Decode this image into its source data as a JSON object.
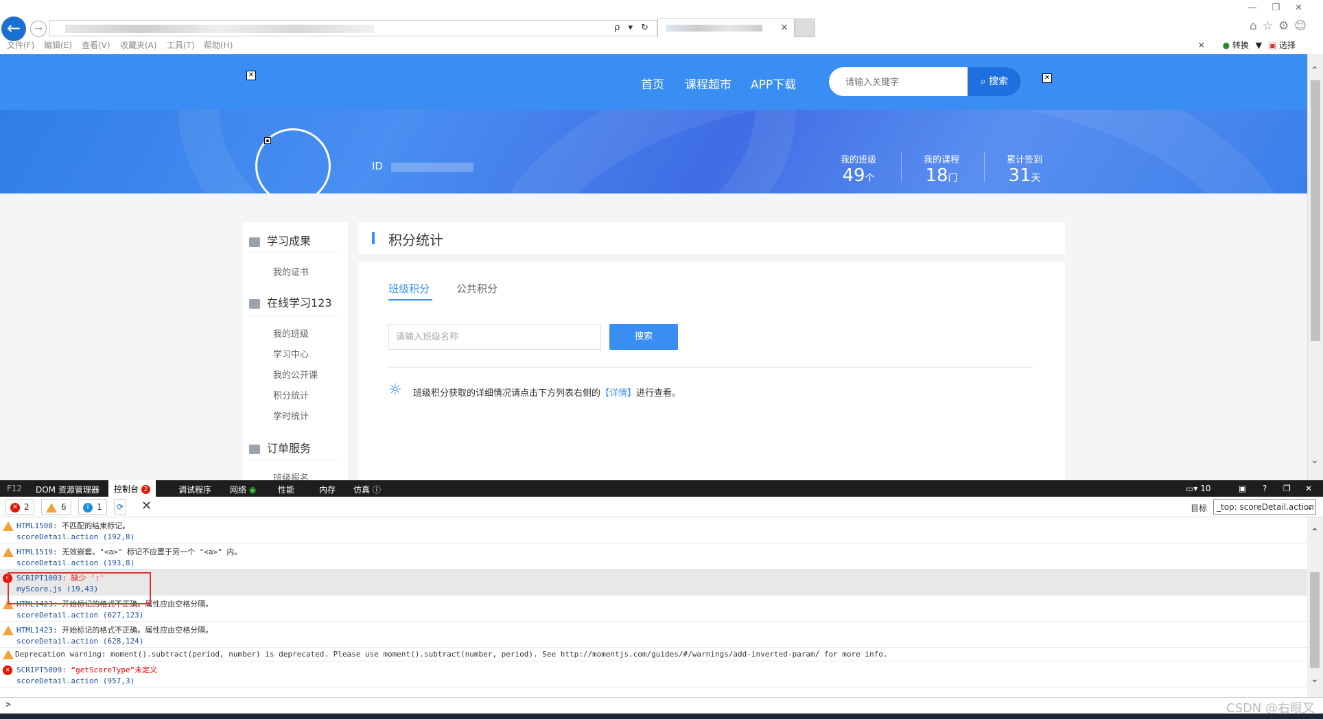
{
  "browser": {
    "menu": [
      "文件(F)",
      "编辑(E)",
      "查看(V)",
      "收藏夹(A)",
      "工具(T)",
      "帮助(H)"
    ],
    "right_tools": [
      "转换",
      "选择"
    ],
    "addr_controls": "ρ ▾ ↻"
  },
  "site": {
    "nav": [
      "首页",
      "课程超市",
      "APP下载"
    ],
    "search_placeholder": "请输入关键字",
    "search_button": "搜索",
    "user_id_label": "ID",
    "stats": [
      {
        "label": "我的班级",
        "value": "49",
        "unit": "个"
      },
      {
        "label": "我的课程",
        "value": "18",
        "unit": "门"
      },
      {
        "label": "累计签到",
        "value": "31",
        "unit": "天"
      }
    ]
  },
  "sidebar": {
    "sections": [
      {
        "title": "学习成果",
        "items": [
          "我的证书"
        ]
      },
      {
        "title": "在线学习123",
        "items": [
          "我的班级",
          "学习中心",
          "我的公开课",
          "积分统计",
          "学时统计"
        ]
      },
      {
        "title": "订单服务",
        "items": [
          "班级报名"
        ]
      }
    ]
  },
  "content": {
    "title": "积分统计",
    "tabs": [
      "班级积分",
      "公共积分"
    ],
    "class_input_placeholder": "请输入班级名称",
    "search_button": "搜索",
    "tip_before": "班级积分获取的详细情况请点击下方列表右侧的",
    "tip_link": "【详情】",
    "tip_after": "进行查看。"
  },
  "devtools": {
    "tabs": [
      "F12",
      "DOM 资源管理器",
      "控制台",
      "调试程序",
      "网络",
      "性能",
      "内存",
      "仿真"
    ],
    "console_error_badge": "2",
    "right_value": "10",
    "filter_counts": {
      "errors": "2",
      "warnings": "6",
      "info": "1"
    },
    "target_label": "目标",
    "target_value": "_top: scoreDetail.action"
  },
  "console": {
    "messages": [
      {
        "level": "warning",
        "code": "HTML1508",
        "text": ": 不匹配的结束标记。",
        "source": "scoreDetail.action (192,8)"
      },
      {
        "level": "warning",
        "code": "HTML1519",
        "text": ": 无效嵌套。\"<a>\" 标记不应置于另一个 \"<a>\" 内。",
        "source": "scoreDetail.action (193,8)"
      },
      {
        "level": "error",
        "code": "SCRIPT1003",
        "text": ": 缺少 ':'",
        "source": "myScore.js (19,43)"
      },
      {
        "level": "warning",
        "code": "HTML1423",
        "text": ": 开始标记的格式不正确。属性应由空格分隔。",
        "source": "scoreDetail.action (627,123)"
      },
      {
        "level": "warning",
        "code": "HTML1423",
        "text": ": 开始标记的格式不正确。属性应由空格分隔。",
        "source": "scoreDetail.action (628,124)"
      },
      {
        "level": "warning",
        "code": "",
        "text": "Deprecation warning: moment().subtract(period, number) is deprecated. Please use moment().subtract(number, period). See http://momentjs.com/guides/#/warnings/add-inverted-param/ for more info.",
        "source": ""
      },
      {
        "level": "error",
        "code": "SCRIPT5009",
        "text": ": “getScoreType”未定义",
        "source": "scoreDetail.action (957,3)"
      }
    ],
    "prompt": ">"
  },
  "watermark": "CSDN @右眼叉"
}
